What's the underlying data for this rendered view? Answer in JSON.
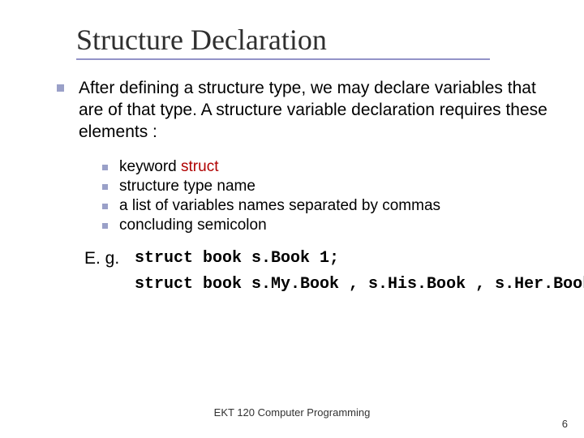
{
  "title": "Structure Declaration",
  "body": {
    "intro": "After defining a structure type, we may declare variables that are of that type. A structure variable declaration requires these elements :",
    "items": [
      {
        "prefix": "keyword ",
        "keyword": "struct"
      },
      {
        "text": "structure type name"
      },
      {
        "text": "a list of variables  names separated by commas"
      },
      {
        "text": "concluding semicolon"
      }
    ],
    "eg_label": "E. g.",
    "code_line1": "struct book s.Book 1;",
    "code_line2": "struct book s.My.Book , s.His.Book , s.Her.Book;"
  },
  "footer": "EKT 120 Computer Programming",
  "page_number": "6"
}
